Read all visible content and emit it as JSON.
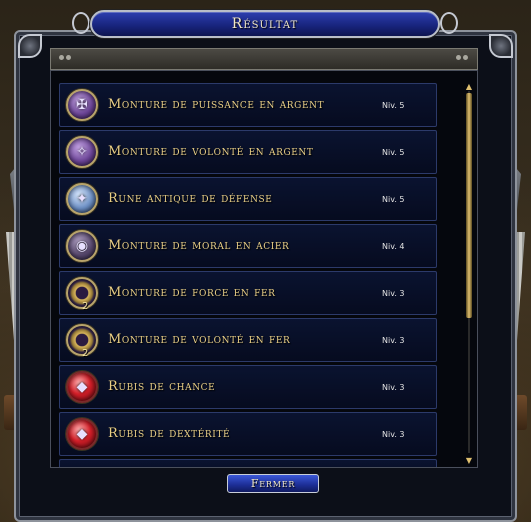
{
  "window": {
    "title": "Résultat",
    "close_label": "Fermer"
  },
  "colors": {
    "title_plate": "#1f2d95",
    "item_text": "#e9cf86",
    "item_bg": "#0a1330",
    "frame_bg": "#0c0f18"
  },
  "items": [
    {
      "name": "Monture de puissance en argent",
      "level": "Niv. 5",
      "icon": "mount-silver-power-icon"
    },
    {
      "name": "Monture de volonté en argent",
      "level": "Niv. 5",
      "icon": "mount-silver-will-icon"
    },
    {
      "name": "Rune antique de défense",
      "level": "Niv. 5",
      "icon": "ancient-defense-rune-icon"
    },
    {
      "name": "Monture de moral en acier",
      "level": "Niv. 4",
      "icon": "mount-steel-morale-icon"
    },
    {
      "name": "Monture de force en fer",
      "level": "Niv. 3",
      "icon": "mount-iron-might-icon",
      "quantity": "2"
    },
    {
      "name": "Monture de volonté en fer",
      "level": "Niv. 3",
      "icon": "mount-iron-will-icon",
      "quantity": "2"
    },
    {
      "name": "Rubis de chance",
      "level": "Niv. 3",
      "icon": "ruby-luck-icon"
    },
    {
      "name": "Rubis de dextérité",
      "level": "Niv. 3",
      "icon": "ruby-dexterity-icon"
    }
  ]
}
